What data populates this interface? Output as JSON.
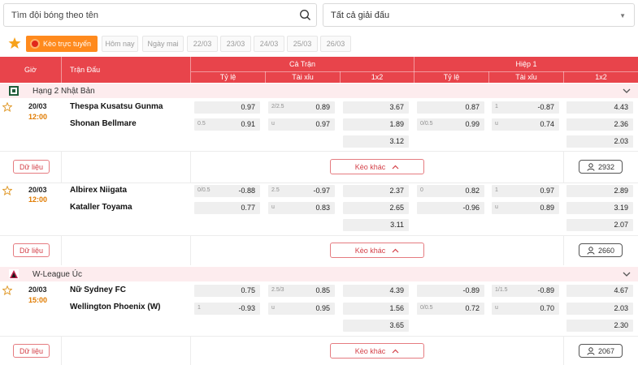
{
  "search": {
    "placeholder": "Tìm đội bóng theo tên"
  },
  "league_select": {
    "value": "Tất cả giải đấu"
  },
  "filters": [
    "Kèo trực tuyến",
    "Hôm nay",
    "Ngày mai",
    "22/03",
    "23/03",
    "24/03",
    "25/03",
    "26/03"
  ],
  "header": {
    "time": "Giờ",
    "match": "Trận Đấu",
    "full": "Cả Trận",
    "half": "Hiệp 1",
    "handicap": "Tỷ lệ",
    "overunder": "Tài xỉu",
    "x12": "1x2",
    "handicap2": "Tỷ lệ",
    "overunder2": "Tài xỉu",
    "x12_2": "1x2"
  },
  "leagues": [
    {
      "name": "Hạng 2 Nhật Bản"
    },
    {
      "name": "W-League Úc"
    }
  ],
  "matches": [
    {
      "date": "20/03",
      "time": "12:00",
      "home": "Thespa Kusatsu Gunma",
      "away": "Shonan Bellmare",
      "ft_hdp": [
        {
          "h": "",
          "v": "0.97"
        },
        {
          "h": "0.5",
          "v": "0.91"
        }
      ],
      "ft_ou": [
        {
          "h": "2/2.5",
          "v": "0.89"
        },
        {
          "h": "u",
          "v": "0.97"
        }
      ],
      "ft_1x2": [
        "3.67",
        "1.89",
        "3.12"
      ],
      "h1_hdp": [
        {
          "h": "",
          "v": "0.87"
        },
        {
          "h": "0/0.5",
          "v": "0.99"
        }
      ],
      "h1_ou": [
        {
          "h": "1",
          "v": "-0.87"
        },
        {
          "h": "u",
          "v": "0.74"
        }
      ],
      "h1_1x2": [
        "4.43",
        "2.36",
        "2.03"
      ],
      "data_label": "Dữ liệu",
      "more_label": "Kèo khác",
      "count": "2932"
    },
    {
      "date": "20/03",
      "time": "12:00",
      "home": "Albirex Niigata",
      "away": "Kataller Toyama",
      "ft_hdp": [
        {
          "h": "0/0.5",
          "v": "-0.88"
        },
        {
          "h": "",
          "v": "0.77"
        }
      ],
      "ft_ou": [
        {
          "h": "2.5",
          "v": "-0.97"
        },
        {
          "h": "u",
          "v": "0.83"
        }
      ],
      "ft_1x2": [
        "2.37",
        "2.65",
        "3.11"
      ],
      "h1_hdp": [
        {
          "h": "0",
          "v": "0.82"
        },
        {
          "h": "",
          "v": "-0.96"
        }
      ],
      "h1_ou": [
        {
          "h": "1",
          "v": "0.97"
        },
        {
          "h": "u",
          "v": "0.89"
        }
      ],
      "h1_1x2": [
        "2.89",
        "3.19",
        "2.07"
      ],
      "data_label": "Dữ liệu",
      "more_label": "Kèo khác",
      "count": "2660"
    },
    {
      "date": "20/03",
      "time": "15:00",
      "home": "Nữ Sydney FC",
      "away": "Wellington Phoenix (W)",
      "ft_hdp": [
        {
          "h": "",
          "v": "0.75"
        },
        {
          "h": "1",
          "v": "-0.93"
        }
      ],
      "ft_ou": [
        {
          "h": "2.5/3",
          "v": "0.85"
        },
        {
          "h": "u",
          "v": "0.95"
        }
      ],
      "ft_1x2": [
        "4.39",
        "1.56",
        "3.65"
      ],
      "h1_hdp": [
        {
          "h": "",
          "v": "-0.89"
        },
        {
          "h": "0/0.5",
          "v": "0.72"
        }
      ],
      "h1_ou": [
        {
          "h": "1/1.5",
          "v": "-0.89"
        },
        {
          "h": "u",
          "v": "0.70"
        }
      ],
      "h1_1x2": [
        "4.67",
        "2.03",
        "2.30"
      ],
      "data_label": "Dữ liệu",
      "more_label": "Kèo khác",
      "count": "2067"
    }
  ],
  "colors": {
    "header_red": "#e8444b",
    "live_orange": "#ff8a1d",
    "time_orange": "#e07b00",
    "league_bg": "#fdecee"
  }
}
